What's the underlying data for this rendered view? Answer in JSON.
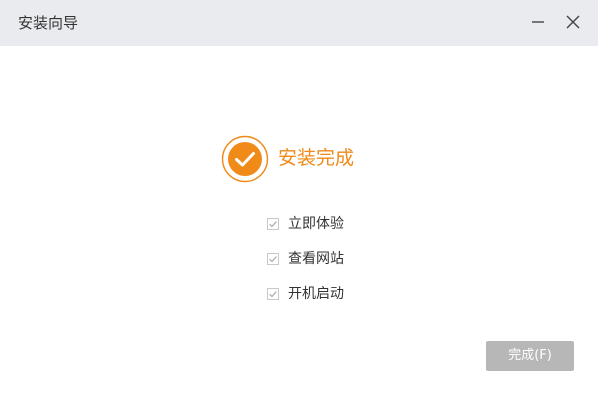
{
  "window": {
    "title": "安装向导"
  },
  "status": {
    "message": "安装完成",
    "icon": "checkmark-circle-icon",
    "accent_color": "#f08a19"
  },
  "options": [
    {
      "label": "立即体验",
      "checked": true
    },
    {
      "label": "查看网站",
      "checked": true
    },
    {
      "label": "开机启动",
      "checked": true
    }
  ],
  "footer": {
    "finish_label": "完成(F)",
    "finish_enabled": false
  }
}
